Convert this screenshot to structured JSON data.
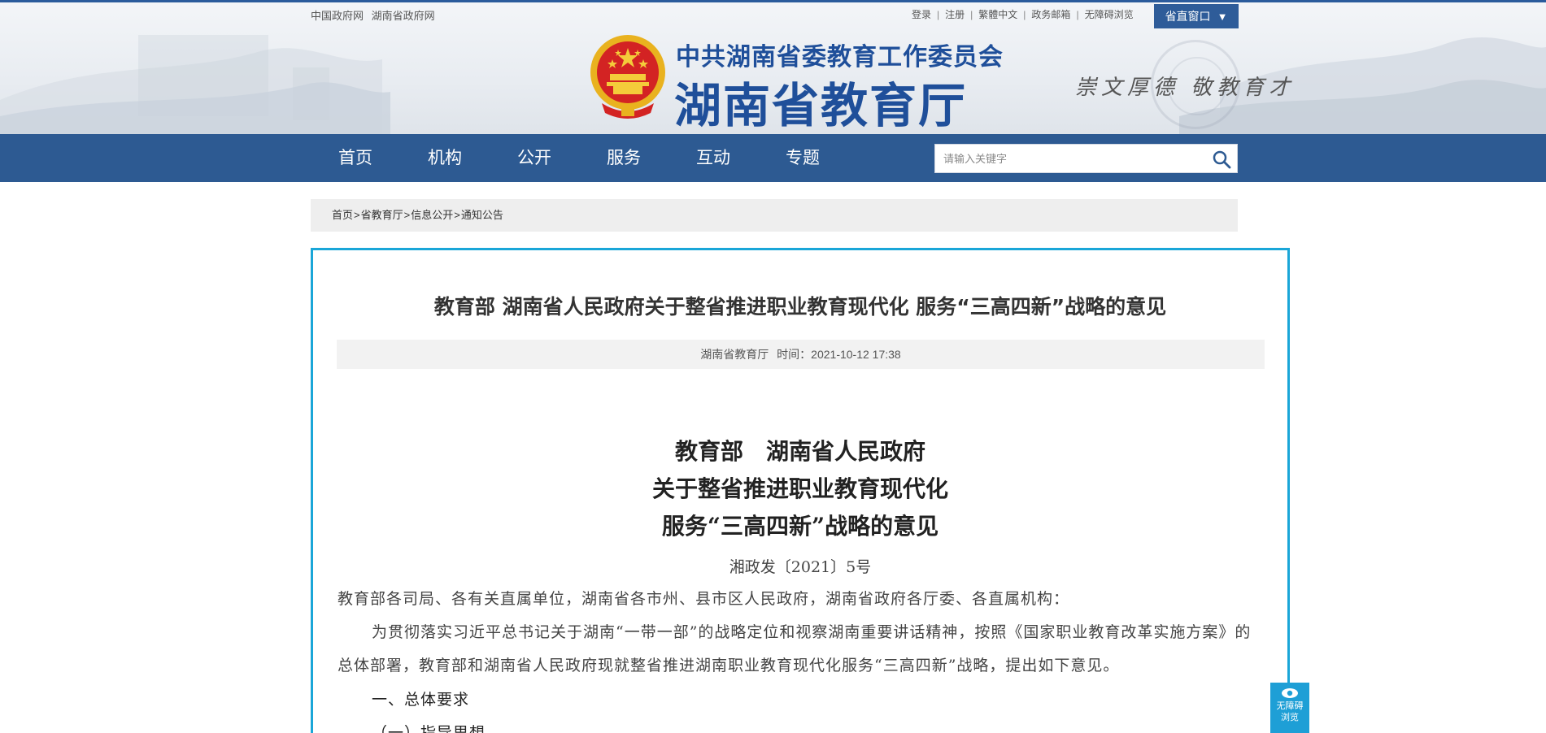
{
  "top_links_left": [
    "中国政府网",
    "湖南省政府网"
  ],
  "top_links_right": [
    "登录",
    "注册",
    "繁體中文",
    "政务邮箱",
    "无障碍浏览"
  ],
  "window_button": {
    "label": "省直窗口",
    "arrow": "▼"
  },
  "logo": {
    "sub_title": "中共湖南省委教育工作委员会",
    "main_title": "湖南省教育厅",
    "slogan": "崇文厚德  敬教育才",
    "emblem_icon": "national-emblem-icon"
  },
  "nav": {
    "items": [
      "首页",
      "机构",
      "公开",
      "服务",
      "互动",
      "专题"
    ],
    "search_placeholder": "请输入关键字",
    "search_icon": "search-icon"
  },
  "breadcrumb": [
    "首页",
    "省教育厅",
    "信息公开",
    "通知公告"
  ],
  "article": {
    "title": "教育部 湖南省人民政府关于整省推进职业教育现代化 服务“三高四新”战略的意见",
    "source": "湖南省教育厅",
    "time": "时间：2021-10-12 17:38",
    "heading_lines": [
      "教育部　湖南省人民政府",
      "关于整省推进职业教育现代化",
      "服务“三高四新”战略的意见"
    ],
    "doc_number": "湘政发〔2021〕5号",
    "recipients": "教育部各司局、各有关直属单位，湖南省各市州、县市区人民政府，湖南省政府各厅委、各直属机构：",
    "body": "为贯彻落实习近平总书记关于湖南“一带一部”的战略定位和视察湖南重要讲话精神，按照《国家职业教育改革实施方案》的总体部署，教育部和湖南省人民政府现就整省推进湖南职业教育现代化服务“三高四新”战略，提出如下意见。",
    "section1": "一、总体要求",
    "section2": "（一）指导思想"
  },
  "accessibility_float": {
    "line1": "无障碍",
    "line2": "浏览",
    "icon": "eye-icon"
  },
  "colors": {
    "nav_bg": "#2d5a92",
    "brand_blue": "#1f4f9a",
    "article_border": "#1aa6d8",
    "float_bg": "#1e9fd6"
  }
}
